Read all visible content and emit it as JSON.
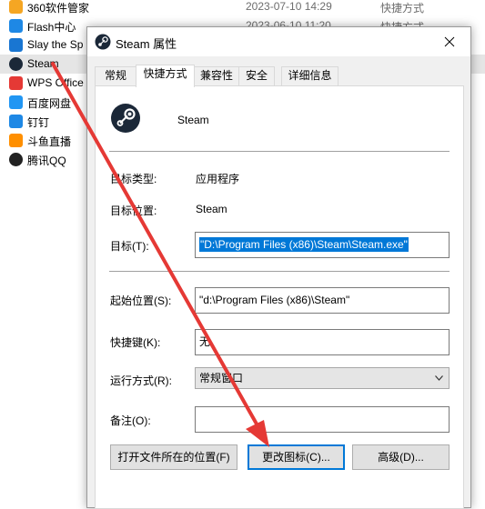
{
  "background_list": {
    "rows": [
      {
        "name": "360软件管家",
        "date": "2023-07-10 14:29",
        "type": "快捷方式",
        "icon": "360-icon",
        "color": "#f5a623"
      },
      {
        "name": "Flash中心",
        "date": "2023-06-10 11:20",
        "type": "快捷方式",
        "icon": "flash-icon",
        "color": "#1e88e5"
      },
      {
        "name": "Slay the Sp",
        "date": "",
        "type": "",
        "icon": "slay-the-spire-icon",
        "color": "#1976d2"
      },
      {
        "name": "Steam",
        "date": "",
        "type": "",
        "icon": "steam-icon",
        "color": "#1b2838"
      },
      {
        "name": "WPS Office",
        "date": "",
        "type": "",
        "icon": "wps-icon",
        "color": "#e53935"
      },
      {
        "name": "百度网盘",
        "date": "",
        "type": "",
        "icon": "baidu-netdisk-icon",
        "color": "#2196f3"
      },
      {
        "name": "钉钉",
        "date": "",
        "type": "",
        "icon": "dingtalk-icon",
        "color": "#1e88e5"
      },
      {
        "name": "斗鱼直播",
        "date": "",
        "type": "",
        "icon": "douyu-icon",
        "color": "#ff8f00"
      },
      {
        "name": "腾讯QQ",
        "date": "",
        "type": "",
        "icon": "qq-icon",
        "color": "#222222"
      }
    ]
  },
  "dialog": {
    "title": "Steam 属性",
    "tabs": [
      {
        "label": "常规"
      },
      {
        "label": "快捷方式"
      },
      {
        "label": "兼容性"
      },
      {
        "label": "安全"
      },
      {
        "label": "详细信息"
      }
    ],
    "app_name": "Steam",
    "target_type_label": "目标类型:",
    "target_type_value": "应用程序",
    "target_location_label": "目标位置:",
    "target_location_value": "Steam",
    "target_label": "目标(T):",
    "target_value": "\"D:\\Program Files (x86)\\Steam\\Steam.exe\"",
    "start_in_label": "起始位置(S):",
    "start_in_value": "\"d:\\Program Files (x86)\\Steam\"",
    "shortcut_key_label": "快捷键(K):",
    "shortcut_key_value": "无",
    "run_label": "运行方式(R):",
    "run_value": "常规窗口",
    "comment_label": "备注(O):",
    "comment_value": "",
    "open_location_button": "打开文件所在的位置(F)",
    "change_icon_button": "更改图标(C)...",
    "advanced_button": "高级(D)..."
  },
  "colors": {
    "annotation_arrow": "#e53935",
    "selection": "#0078d7"
  }
}
